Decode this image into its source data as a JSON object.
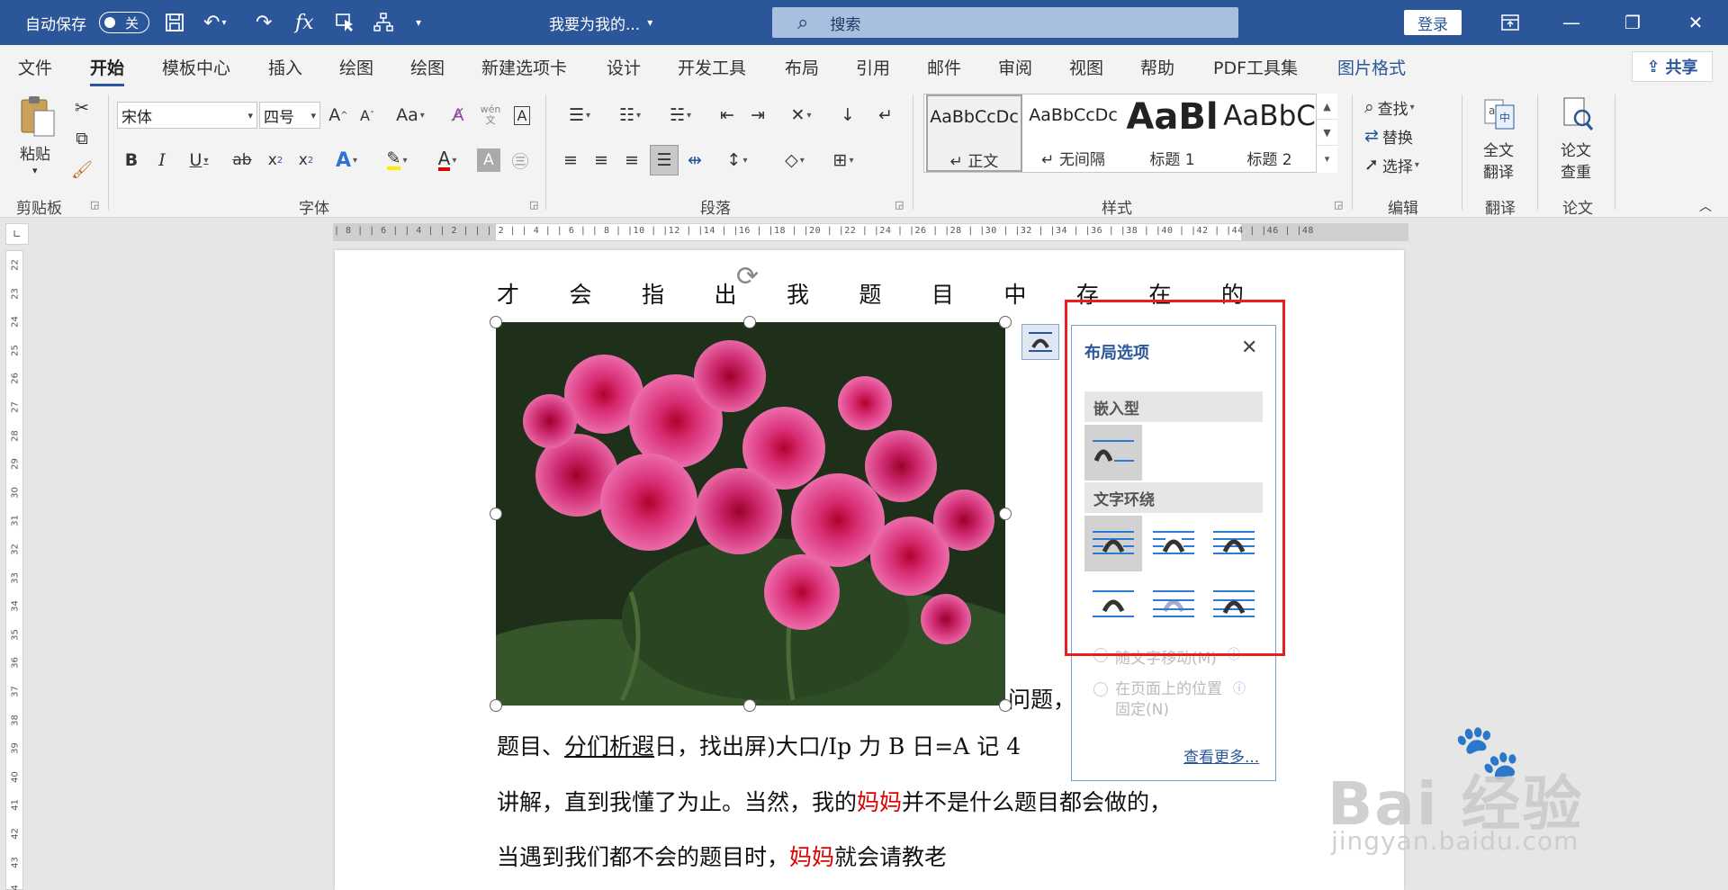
{
  "titlebar": {
    "autosave_label": "自动保存",
    "autosave_state": "关",
    "doc_title": "我要为我的...",
    "search_placeholder": "搜索",
    "login_label": "登录"
  },
  "menu": {
    "tabs": [
      "文件",
      "开始",
      "模板中心",
      "插入",
      "绘图",
      "绘图",
      "新建选项卡",
      "设计",
      "开发工具",
      "布局",
      "引用",
      "邮件",
      "审阅",
      "视图",
      "帮助",
      "PDF工具集",
      "图片格式"
    ],
    "active_tab": "开始",
    "share_label": "共享"
  },
  "ribbon": {
    "clipboard": {
      "paste_label": "粘贴",
      "group_label": "剪贴板"
    },
    "font": {
      "font_name": "宋体",
      "font_size": "四号",
      "group_label": "字体",
      "wen_label": "wén\n文",
      "case_label": "Aa"
    },
    "paragraph": {
      "group_label": "段落"
    },
    "styles": {
      "group_label": "样式",
      "tiles": [
        {
          "sample": "AaBbCcDc",
          "name": "↵ 正文"
        },
        {
          "sample": "AaBbCcDc",
          "name": "↵ 无间隔"
        },
        {
          "sample": "AaBl",
          "name": "标题 1"
        },
        {
          "sample": "AaBbC",
          "name": "标题 2"
        }
      ]
    },
    "editing": {
      "find_label": "查找",
      "replace_label": "替换",
      "select_label": "选择",
      "group_label": "编辑"
    },
    "translate": {
      "button_label_1": "全文",
      "button_label_2": "翻译",
      "group_label": "翻译"
    },
    "thesis": {
      "button_label_1": "论文",
      "button_label_2": "查重",
      "group_label": "论文"
    }
  },
  "ruler": {
    "h_ticks": "| 8 |   | 6 |   | 4 |   | 2 |   |       | 2 |   | 4 |   | 6 |   | 8 |   |10 |   |12 |   |14 |   |16 |   |18 |   |20 |   |22 |   |24 |   |26 |   |28 |   |30 |   |32 |   |34 |   |36 |   |38 |   |40 |   |42 |   |44 |   |46 |   |48",
    "v_ticks": [
      "22",
      "23",
      "24",
      "25",
      "26",
      "27",
      "28",
      "29",
      "30",
      "31",
      "32",
      "33",
      "34",
      "35",
      "36",
      "37",
      "38",
      "39",
      "40",
      "41",
      "42",
      "43",
      "44"
    ]
  },
  "document": {
    "line1_chars": [
      "才",
      "会",
      "指",
      "出",
      "我",
      "题",
      "目",
      "中",
      "存",
      "在",
      "的"
    ],
    "line2_tail": "问题，",
    "line3_a": "题目、",
    "line3_b": "分们析遐",
    "line3_c": "日，找出屏)大口/Ip 力 B 日=A 记 4",
    "line4_a": "讲解，直到我懂了为止。当然，我的",
    "line4_red": "妈妈",
    "line4_b": "并不是什么题目都会做的，",
    "line5_a": "当遇到我们都不会的题目时，",
    "line5_red": "妈妈",
    "line5_b": "就会请教老"
  },
  "layout_pane": {
    "title": "布局选项",
    "inline_heading": "嵌入型",
    "wrap_heading": "文字环绕",
    "radio_move": "随文字移动(M)",
    "radio_fixed_1": "在页面上的位置",
    "radio_fixed_2": "固定(N)",
    "see_more": "查看更多..."
  },
  "watermark": {
    "brand": "Bai 经验",
    "url": "jingyan.baidu.com"
  },
  "colors": {
    "brand_blue": "#2b579a",
    "highlight_red": "#e62020",
    "text_red": "#e00000"
  }
}
